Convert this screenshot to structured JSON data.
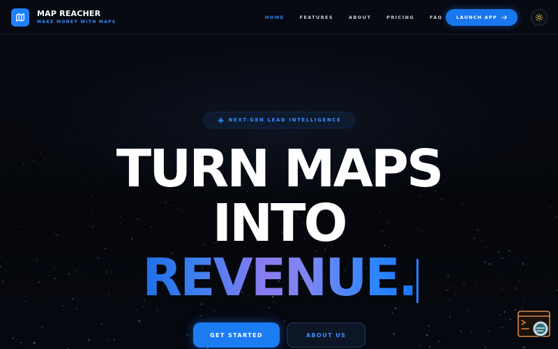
{
  "header": {
    "brand_title": "MAP REACHER",
    "brand_subtitle": "MAKE MONEY WITH MAPS",
    "logo_icon": "map-icon",
    "nav": [
      "HOME",
      "FEATURES",
      "ABOUT",
      "PRICING",
      "FAQ"
    ],
    "active_nav": "HOME",
    "launch_label": "LAUNCH APP",
    "theme_icon": "sun-icon"
  },
  "hero": {
    "badge": "NEXT-GEN LEAD INTELLIGENCE",
    "badge_icon": "sparkle-icon",
    "line1": "TURN MAPS",
    "line2": "INTO",
    "line3": "REVENUE.",
    "primary_cta": "GET STARTED",
    "secondary_cta": "ABOUT US"
  },
  "colors": {
    "accent": "#1f80ff",
    "background": "#05070c",
    "gradient_mid": "#8a7cf0"
  }
}
